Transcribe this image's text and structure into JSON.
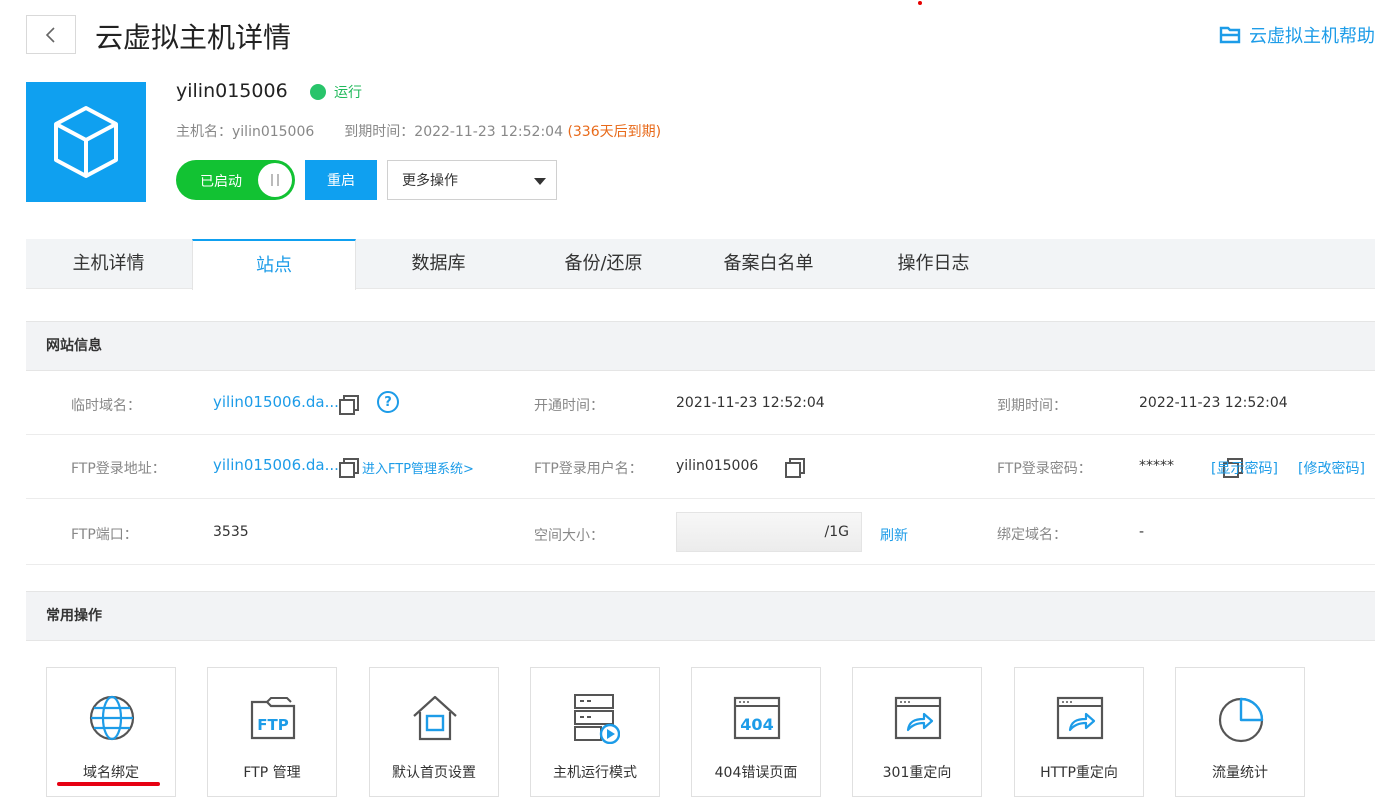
{
  "header": {
    "title": "云虚拟主机详情",
    "help_link": "云虚拟主机帮助"
  },
  "host": {
    "name": "yilin015006",
    "status": "运行",
    "hostname_label": "主机名：",
    "hostname_value": "yilin015006",
    "expire_label": "到期时间：",
    "expire_value": "2022-11-23 12:52:04",
    "expire_remaining": "(336天后到期)",
    "toggle_label": "已启动",
    "restart_label": "重启",
    "more_ops_label": "更多操作"
  },
  "tabs": [
    {
      "label": "主机详情"
    },
    {
      "label": "站点"
    },
    {
      "label": "数据库"
    },
    {
      "label": "备份/还原"
    },
    {
      "label": "备案白名单"
    },
    {
      "label": "操作日志"
    }
  ],
  "site_info": {
    "title": "网站信息",
    "temp_domain_label": "临时域名：",
    "temp_domain_value": "yilin015006.da...",
    "open_time_label": "开通时间：",
    "open_time_value": "2021-11-23 12:52:04",
    "expire_time_label": "到期时间：",
    "expire_time_value": "2022-11-23 12:52:04",
    "ftp_addr_label": "FTP登录地址：",
    "ftp_addr_value": "yilin015006.da...",
    "ftp_manage_link": "进入FTP管理系统>",
    "ftp_user_label": "FTP登录用户名：",
    "ftp_user_value": "yilin015006",
    "ftp_pwd_label": "FTP登录密码：",
    "ftp_pwd_value": "*****",
    "show_pwd_link": "[显示密码]",
    "change_pwd_link": "[修改密码]",
    "ftp_port_label": "FTP端口：",
    "ftp_port_value": "3535",
    "space_label": "空间大小：",
    "space_value": "/1G",
    "refresh_link": "刷新",
    "bound_domain_label": "绑定域名：",
    "bound_domain_value": "-"
  },
  "common_ops": {
    "title": "常用操作",
    "items": [
      {
        "label": "域名绑定",
        "icon": "globe-icon"
      },
      {
        "label": "FTP 管理",
        "icon": "ftp-folder-icon"
      },
      {
        "label": "默认首页设置",
        "icon": "home-icon"
      },
      {
        "label": "主机运行模式",
        "icon": "server-play-icon"
      },
      {
        "label": "404错误页面",
        "icon": "error-404-icon"
      },
      {
        "label": "301重定向",
        "icon": "redirect-icon"
      },
      {
        "label": "HTTP重定向",
        "icon": "http-redirect-icon"
      },
      {
        "label": "流量统计",
        "icon": "pie-chart-icon"
      }
    ],
    "ftp_icon_text": "FTP",
    "error_icon_text": "404"
  },
  "colors": {
    "accent": "#0fa0f0",
    "link": "#1d9ce8",
    "running": "#28c46a",
    "toggle_on": "#12c233",
    "warn": "#e86a1a",
    "highlight": "#e60012"
  }
}
